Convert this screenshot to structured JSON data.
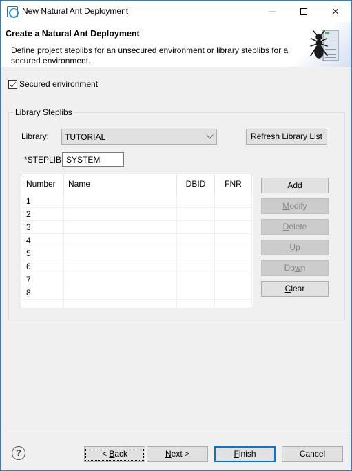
{
  "window": {
    "title": "New Natural Ant Deployment",
    "icon": "app-icon",
    "controls": {
      "minimize": "minimize-icon",
      "maximize": "maximize-icon",
      "close": "×"
    }
  },
  "header": {
    "title": "Create a Natural Ant Deployment",
    "description": "Define project steplibs for an unsecured environment or library steplibs for a secured environment.",
    "graphic": "ant-server-icon"
  },
  "secured": {
    "label": "Secured environment",
    "checked": true
  },
  "group": {
    "legend": "Library Steplibs",
    "library_label": "Library:",
    "library_value": "TUTORIAL",
    "refresh_label": "Refresh Library List",
    "steplib_label": "*STEPLIB:",
    "steplib_value": "SYSTEM"
  },
  "table": {
    "columns": [
      "Number",
      "Name",
      "DBID",
      "FNR"
    ],
    "rows": [
      {
        "number": "1",
        "name": "",
        "dbid": "",
        "fnr": ""
      },
      {
        "number": "2",
        "name": "",
        "dbid": "",
        "fnr": ""
      },
      {
        "number": "3",
        "name": "",
        "dbid": "",
        "fnr": ""
      },
      {
        "number": "4",
        "name": "",
        "dbid": "",
        "fnr": ""
      },
      {
        "number": "5",
        "name": "",
        "dbid": "",
        "fnr": ""
      },
      {
        "number": "6",
        "name": "",
        "dbid": "",
        "fnr": ""
      },
      {
        "number": "7",
        "name": "",
        "dbid": "",
        "fnr": ""
      },
      {
        "number": "8",
        "name": "",
        "dbid": "",
        "fnr": ""
      },
      {
        "number": "",
        "name": "",
        "dbid": "",
        "fnr": ""
      }
    ]
  },
  "side_buttons": [
    {
      "label": "Add",
      "mnemonic": "A",
      "rest": "dd",
      "pre": "",
      "enabled": true
    },
    {
      "label": "Modify",
      "mnemonic": "M",
      "rest": "odify",
      "pre": "",
      "enabled": false
    },
    {
      "label": "Delete",
      "mnemonic": "D",
      "rest": "elete",
      "pre": "",
      "enabled": false
    },
    {
      "label": "Up",
      "mnemonic": "U",
      "rest": "p",
      "pre": "",
      "enabled": false
    },
    {
      "label": "Down",
      "mnemonic": "w",
      "rest": "n",
      "pre": "Do",
      "enabled": false
    },
    {
      "label": "Clear",
      "mnemonic": "C",
      "rest": "lear",
      "pre": "",
      "enabled": true
    }
  ],
  "footer": {
    "help": "?",
    "back": {
      "pre": "< ",
      "mnemonic": "B",
      "rest": "ack"
    },
    "next": {
      "pre": "",
      "mnemonic": "N",
      "rest": "ext >"
    },
    "finish": {
      "pre": "",
      "mnemonic": "F",
      "rest": "inish"
    },
    "cancel": "Cancel"
  },
  "colors": {
    "accent": "#0078d7",
    "window_border": "#1883d7",
    "background": "#f0f0f0"
  }
}
